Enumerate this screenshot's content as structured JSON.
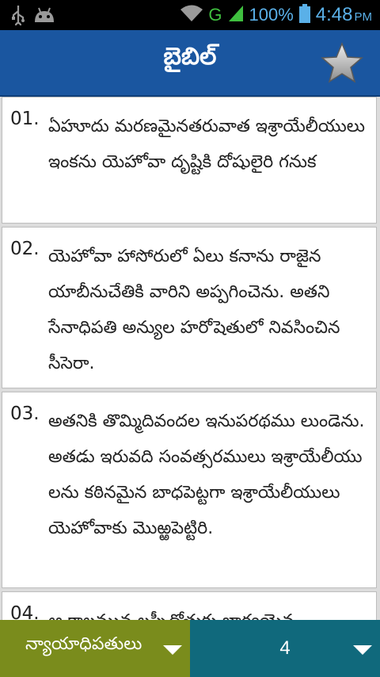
{
  "status_bar": {
    "network": "G",
    "battery": "100%",
    "time": "4:48",
    "ampm": "PM",
    "icons": [
      "usb-icon",
      "android-icon",
      "wifi-icon",
      "signal-icon",
      "battery-icon"
    ]
  },
  "app_bar": {
    "title": "బైబిల్",
    "action_icon": "star-icon"
  },
  "verses": [
    {
      "number": "01.",
      "text": "ఏహూదు మరణమైనతరువాత ఇశ్రాయేలీయులు ఇంకను యెహోవా దృష్టికి దోషులైరి గనుక"
    },
    {
      "number": "02.",
      "text": "యెహోవా హాసోరులో ఏలు కనాను రాజైన యాబీనుచేతికి  వారిని అప్పగించెను. అతని సేనాధిపతి అన్యుల హరోషెతులో నివసించిన సీసెరా."
    },
    {
      "number": "03.",
      "text": "అతనికి తొమ్మిదివందల ఇనుపరథము లుండెను. అతడు ఇరువది సంవత్సరములు ఇశ్రాయేలీయు లను కఠినమైన బాధపెట్టగా ఇశ్రాయేలీయులు యెహోవాకు మొఱ్ఱపెట్టిరి."
    },
    {
      "number": "04.",
      "text": "ఆ కాలమున లప్పీదోతుకు భార్యయైన"
    }
  ],
  "bottom_bar": {
    "book": "న్యాయాధిపతులు",
    "chapter": "4"
  },
  "colors": {
    "app_bar": "#1a56a0",
    "book_selector": "#7a8c1c",
    "chapter_selector": "#10697c",
    "status_icons": "#5ab0e8"
  }
}
